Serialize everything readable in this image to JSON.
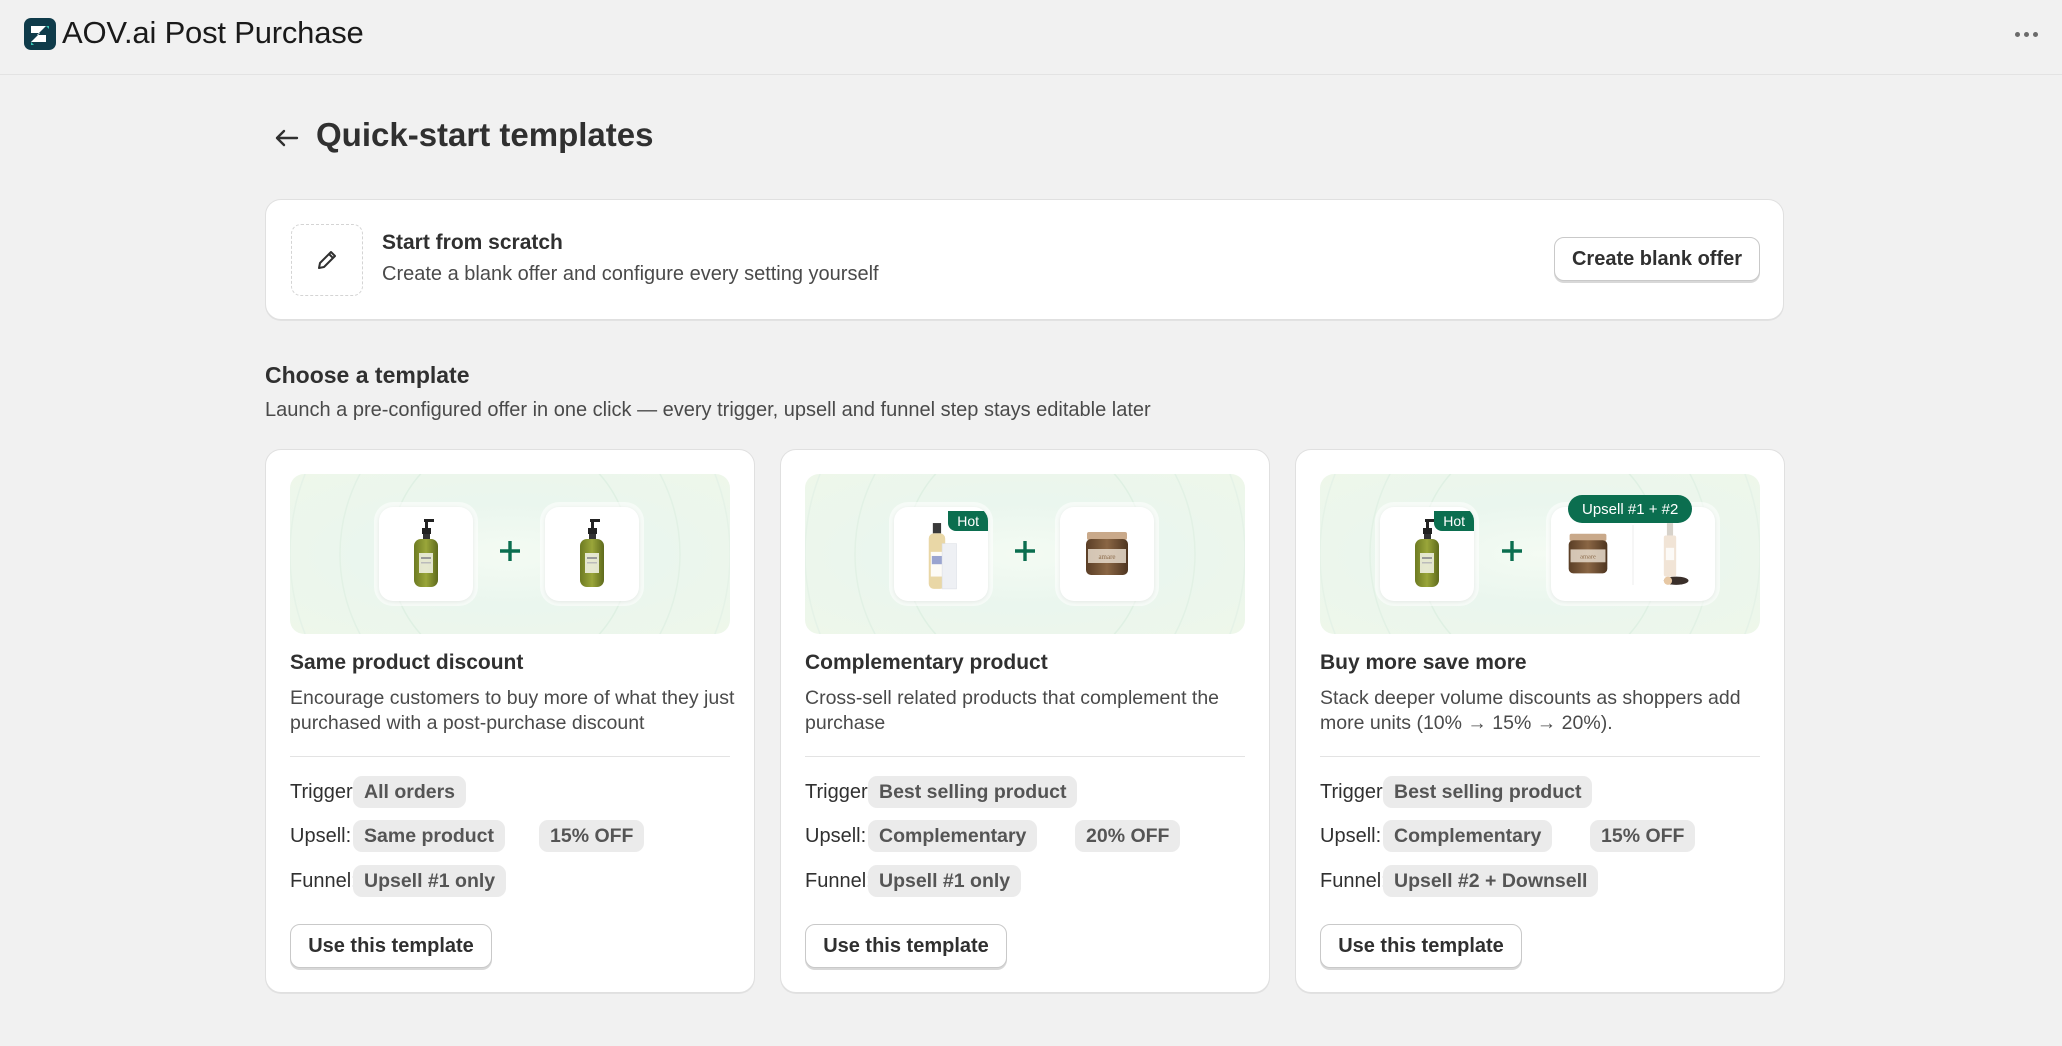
{
  "app": {
    "title": "AOV.ai Post Purchase",
    "more_icon": "ellipsis-icon"
  },
  "page": {
    "title": "Quick-start templates",
    "back_icon": "arrow-left-icon"
  },
  "scratch": {
    "icon": "pencil-icon",
    "title": "Start from scratch",
    "description": "Create a blank offer and configure every setting yourself",
    "button_label": "Create blank offer"
  },
  "section": {
    "title": "Choose a template",
    "description": "Launch a pre-configured offer in one click — every trigger, upsell and funnel step stays editable later"
  },
  "labels": {
    "trigger": "Trigger:",
    "upsell": "Upsell:",
    "funnel": "Funnel:"
  },
  "templates": [
    {
      "title": "Same product discount",
      "description": "Encourage customers to buy more of what they just purchased with a post-purchase discount",
      "trigger": "All orders",
      "upsell": "Same product",
      "discount": "15% OFF",
      "funnel": "Upsell #1 only",
      "button_label": "Use this template"
    },
    {
      "title": "Complementary product",
      "description": "Cross-sell related products that complement the purchase",
      "badge": "Hot",
      "trigger": "Best selling product",
      "upsell": "Complementary",
      "discount": "20% OFF",
      "funnel": "Upsell #1 only",
      "button_label": "Use this template"
    },
    {
      "title": "Buy more save more",
      "description": "Stack deeper volume discounts as shoppers add more units (10% → 15% → 20%).",
      "badge": "Hot",
      "upsell_badge": "Upsell #1 + #2",
      "trigger": "Best selling product",
      "upsell": "Complementary",
      "discount": "15% OFF",
      "funnel": "Upsell #2 + Downsell",
      "button_label": "Use this template"
    }
  ],
  "colors": {
    "accent": "#0b6e4f",
    "background": "#f1f1f1"
  }
}
